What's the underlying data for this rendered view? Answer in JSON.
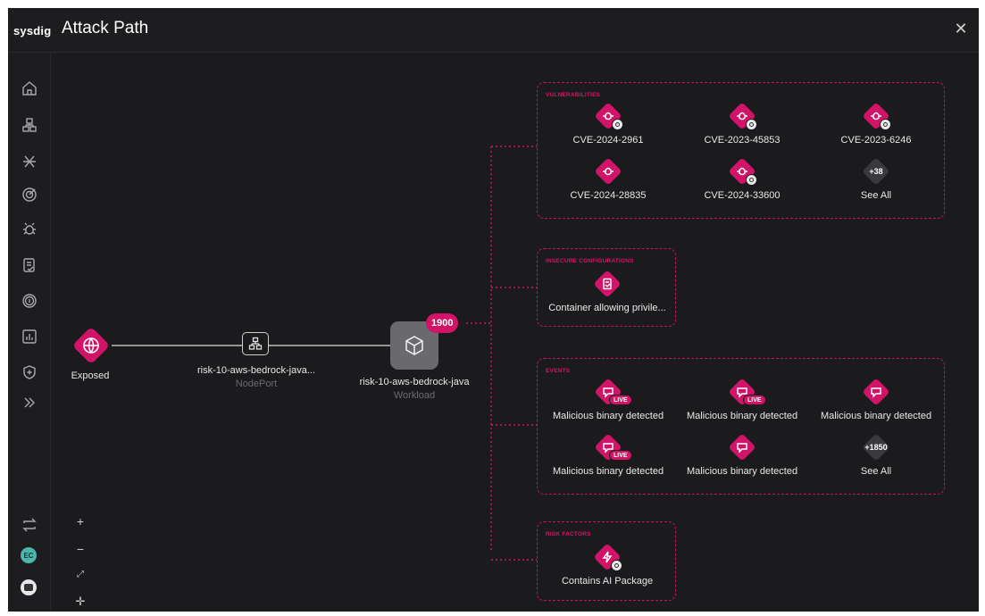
{
  "header": {
    "brand": "sysdig",
    "title": "Attack Path",
    "close_icon": "close-icon"
  },
  "sidebar": {
    "icons": [
      "home-icon",
      "inventory-icon",
      "integrations-icon",
      "target-icon",
      "bug-icon",
      "policy-icon",
      "fingerprint-icon",
      "chart-icon",
      "shield-icon",
      "expand-icon"
    ],
    "bottom_icons": [
      "switch-icon"
    ],
    "avatar_initials": "EC"
  },
  "zoom_controls": {
    "zoom_in": "+",
    "zoom_out": "−",
    "fit_icon": "fit-icon",
    "center_icon": "center-icon"
  },
  "path": {
    "exposed": {
      "label": "Exposed"
    },
    "service": {
      "label": "risk-10-aws-bedrock-java...",
      "sub": "NodePort"
    },
    "workload": {
      "label": "risk-10-aws-bedrock-java",
      "sub": "Workload",
      "count": "1900"
    }
  },
  "groups": {
    "vulnerabilities": {
      "title": "VULNERABILITIES",
      "items": [
        {
          "label": "CVE-2024-2961"
        },
        {
          "label": "CVE-2023-45853"
        },
        {
          "label": "CVE-2023-6246"
        },
        {
          "label": "CVE-2024-28835"
        },
        {
          "label": "CVE-2024-33600"
        },
        {
          "label": "See All",
          "more": "+38"
        }
      ]
    },
    "insecure": {
      "title": "INSECURE CONFIGURATIONS",
      "items": [
        {
          "label": "Container allowing privile..."
        }
      ]
    },
    "events": {
      "title": "EVENTS",
      "live_label": "LIVE",
      "items": [
        {
          "label": "Malicious binary detected"
        },
        {
          "label": "Malicious binary detected"
        },
        {
          "label": "Malicious binary detected"
        },
        {
          "label": "Malicious binary detected"
        },
        {
          "label": "Malicious binary detected"
        },
        {
          "label": "See All",
          "more": "+1850"
        }
      ]
    },
    "risk_factors": {
      "title": "RISK FACTORS",
      "items": [
        {
          "label": "Contains AI Package"
        }
      ]
    }
  },
  "colors": {
    "accent": "#d21468",
    "background": "#1b1b1d",
    "neutral_badge": "#3a3a3e"
  }
}
